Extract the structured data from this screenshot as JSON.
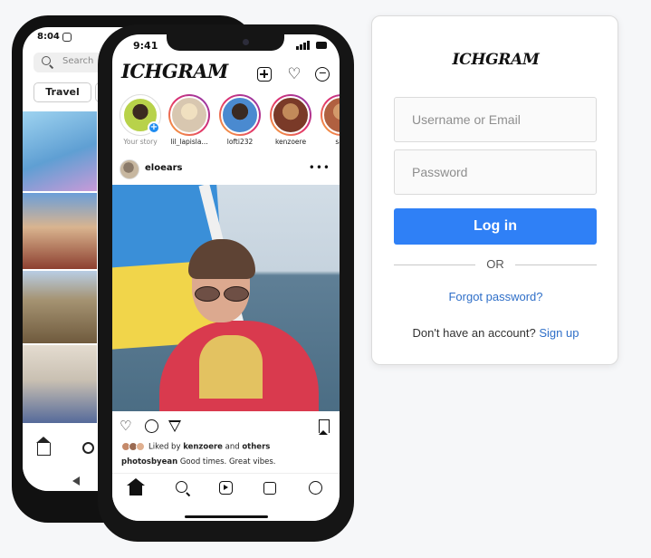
{
  "back_phone": {
    "time": "8:04",
    "search_placeholder": "Search",
    "chip_label": "Travel"
  },
  "front_phone": {
    "time": "9:41",
    "wordmark": "ICHGRAM",
    "stories": [
      {
        "label": "Your story"
      },
      {
        "label": "lil_lapisla..."
      },
      {
        "label": "lofti232"
      },
      {
        "label": "kenzoere"
      },
      {
        "label": "sap"
      }
    ],
    "post": {
      "username": "eloears",
      "liked_by_prefix": "Liked by",
      "liked_by_user": "kenzoere",
      "liked_by_and": "and",
      "liked_by_others": "others",
      "caption_user": "photosbyean",
      "caption_text": "Good times. Great vibes."
    }
  },
  "login": {
    "logo": "ICHGRAM",
    "username_placeholder": "Username or Email",
    "password_placeholder": "Password",
    "login_button": "Log in",
    "or_text": "OR",
    "forgot_link": "Forgot password?",
    "no_account_text": "Don't have an account?",
    "signup_link": "Sign up"
  },
  "colors": {
    "accent": "#2f80f6",
    "link": "#2f6fc8",
    "story_ring": "#e1306c"
  }
}
